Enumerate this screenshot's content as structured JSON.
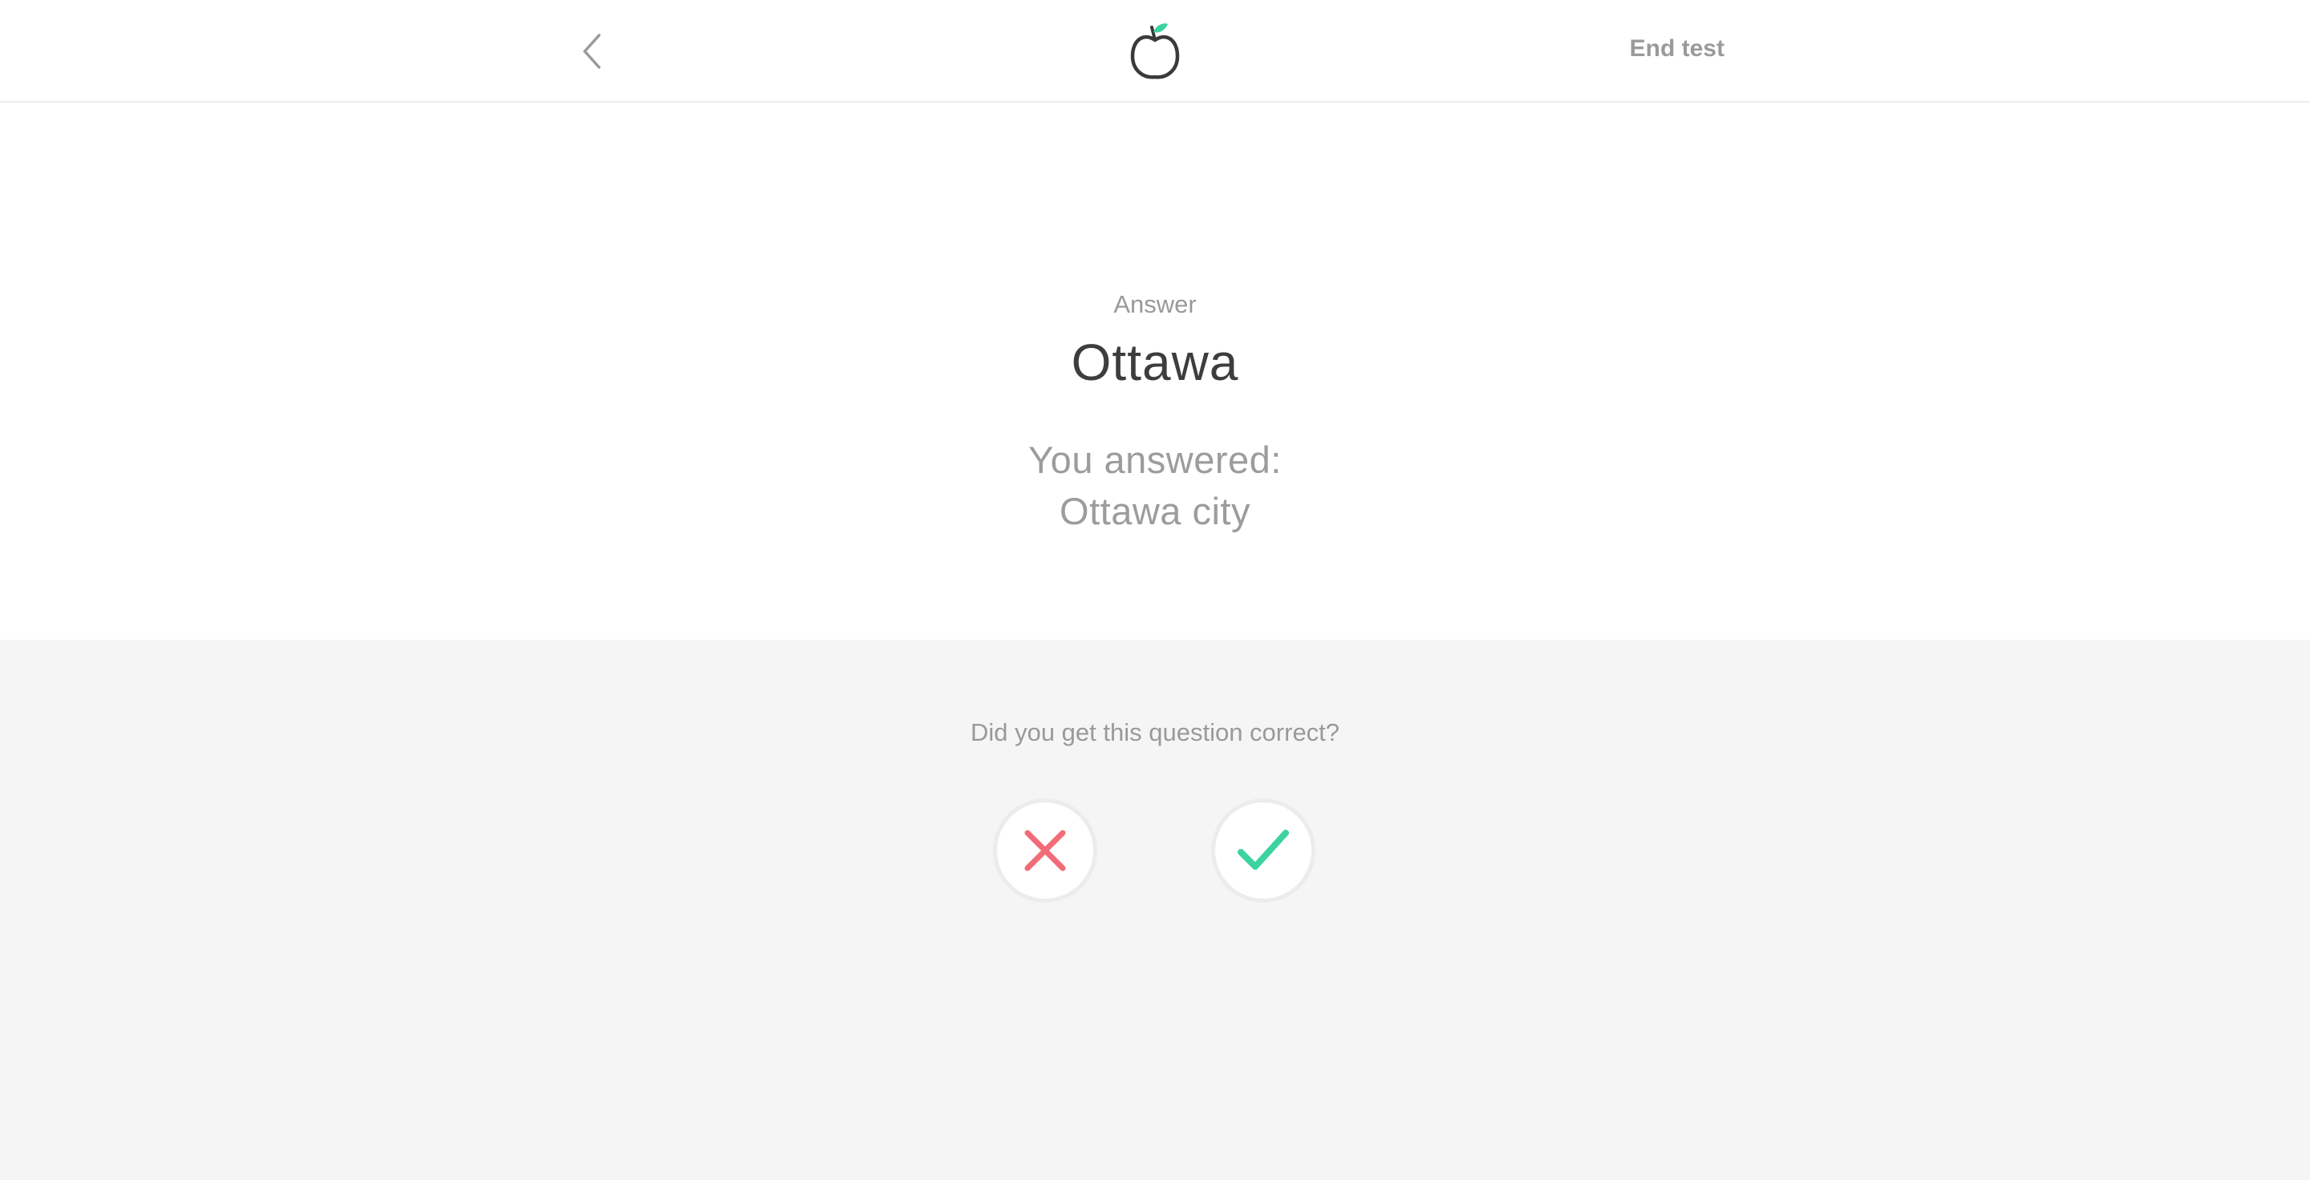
{
  "header": {
    "back_icon": "chevron-left-icon",
    "logo_icon": "apple-logo-icon",
    "end_test_label": "End test"
  },
  "answer": {
    "label": "Answer",
    "value": "Ottawa",
    "you_answered_label": "You answered:",
    "you_answered_value": "Ottawa city"
  },
  "feedback": {
    "question": "Did you get this question correct?",
    "wrong_icon": "x-icon",
    "correct_icon": "check-icon"
  },
  "colors": {
    "wrong": "#f26b78",
    "correct": "#3cd3a0",
    "leaf": "#3cd3a0",
    "logo_outline": "#3a3a3a"
  }
}
